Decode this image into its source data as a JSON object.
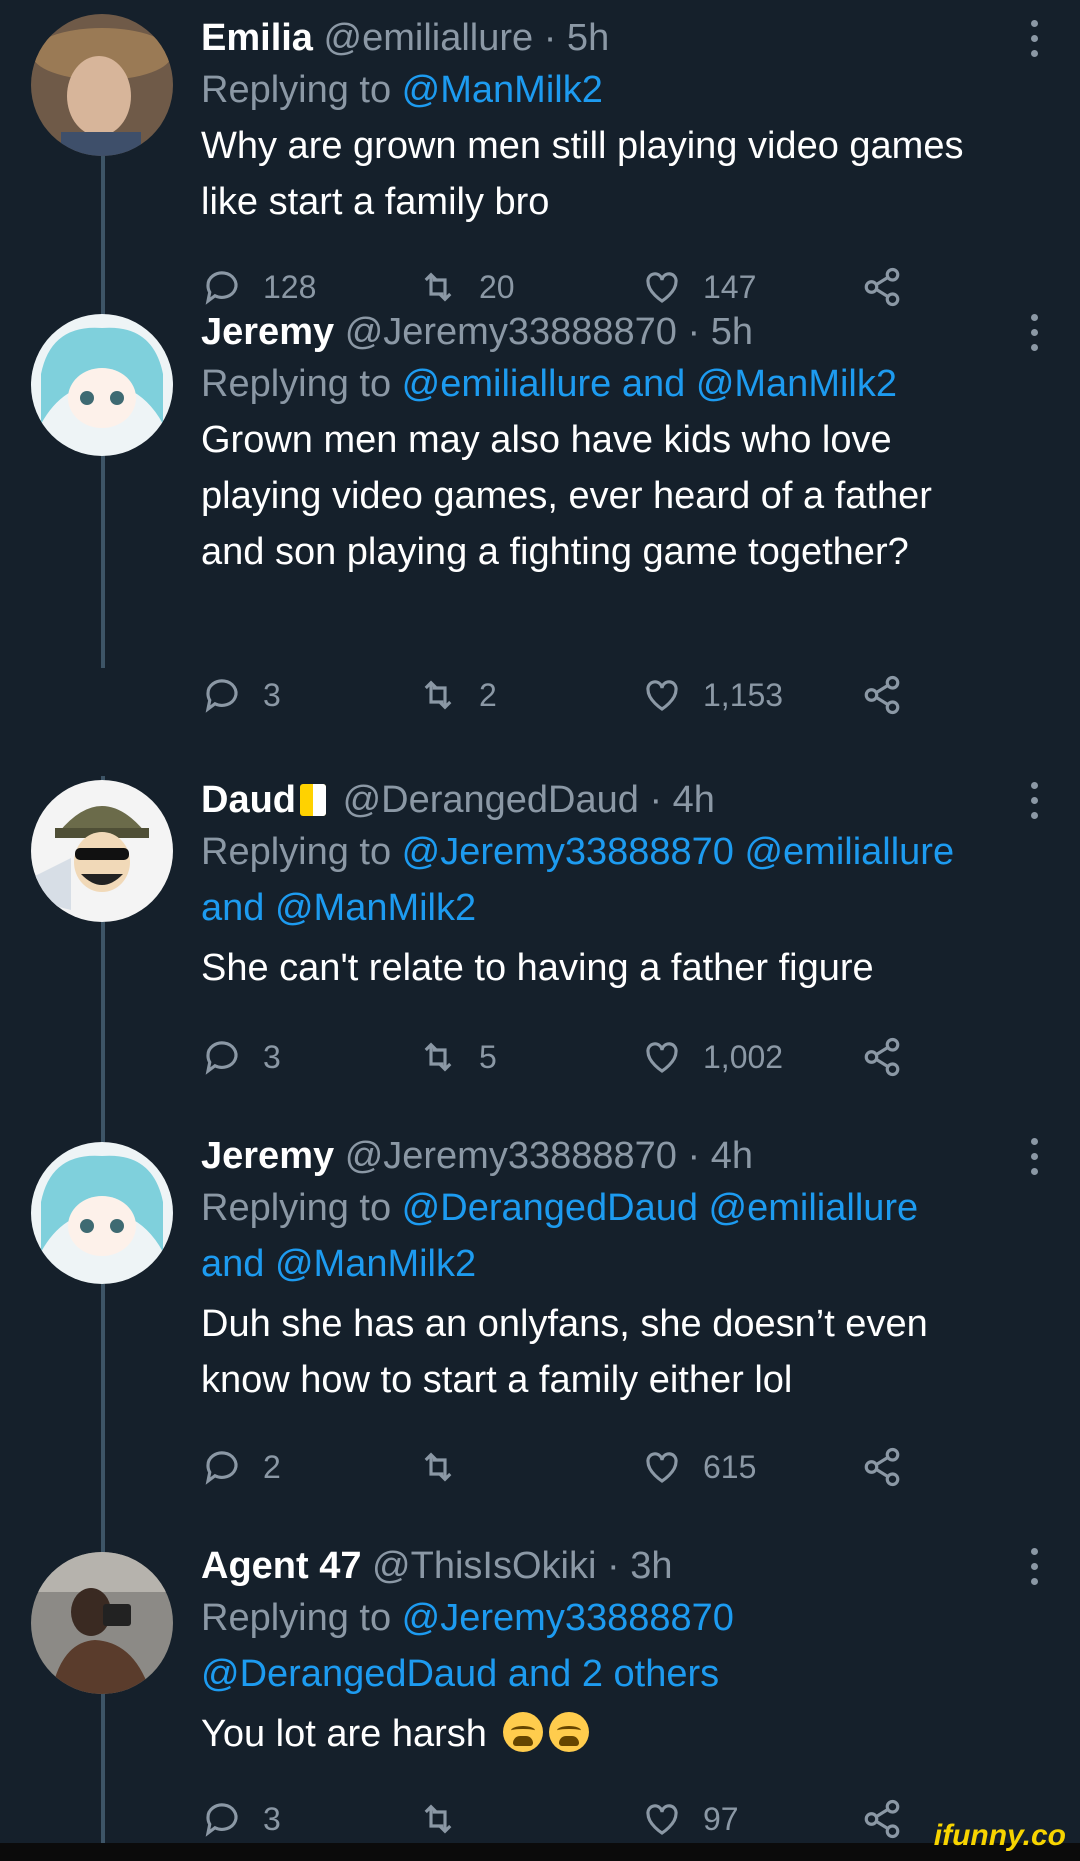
{
  "tweets": [
    {
      "name": "Emilia",
      "handle": "@emiliallure",
      "time": "· 5h",
      "replying_prefix": "Replying to ",
      "replying_to": "@ManMilk2",
      "text_lines": [
        "Why are grown men still playing video games",
        "like start a family bro"
      ],
      "replies": "128",
      "retweets": "20",
      "likes": "147",
      "avatar": "woman-portrait",
      "avatar_color": "#b08a6a"
    },
    {
      "name": "Jeremy",
      "handle": "@Jeremy33888870",
      "time": "· 5h",
      "replying_prefix": "Replying to ",
      "replying_to": "@emiliallure and @ManMilk2",
      "text_lines": [
        "Grown men may also have kids who love",
        "playing video games, ever heard of a father",
        "and son playing a fighting game together?"
      ],
      "replies": "3",
      "retweets": "2",
      "likes": "1,153",
      "avatar": "anime-girl",
      "avatar_color": "#9fdce6"
    },
    {
      "name": "Daud",
      "handle": "@DerangedDaud",
      "time": "· 4h",
      "replying_prefix": "Replying to ",
      "replying_to_line1": "@Jeremy33888870 @emiliallure",
      "replying_to_line2": "and @ManMilk2",
      "text_lines": [
        "She can't relate to having a father figure"
      ],
      "replies": "3",
      "retweets": "5",
      "likes": "1,002",
      "avatar": "anime-bucket-hat",
      "avatar_color": "#6b6b4a"
    },
    {
      "name": "Jeremy",
      "handle": "@Jeremy33888870",
      "time": "· 4h",
      "replying_prefix": "Replying to ",
      "replying_to_line1": "@DerangedDaud @emiliallure",
      "replying_to_line2": "and @ManMilk2",
      "text_lines": [
        "Duh she has an onlyfans, she doesn’t even",
        "know how to start a family either lol"
      ],
      "replies": "2",
      "retweets": "",
      "likes": "615",
      "avatar": "anime-girl",
      "avatar_color": "#9fdce6"
    },
    {
      "name": "Agent 47",
      "handle": "@ThisIsOkiki",
      "time": "· 3h",
      "replying_prefix": "Replying to ",
      "replying_to_line1": "@Jeremy33888870",
      "replying_to_line2": "@DerangedDaud and 2 others",
      "text_lines": [
        "You lot are harsh"
      ],
      "replies": "3",
      "retweets": "",
      "likes": "97",
      "avatar": "man-selfie",
      "avatar_color": "#5a4a3e"
    }
  ],
  "watermark": "ifunny.co",
  "colors": {
    "background": "#15202b",
    "secondary_text": "#8b98a5",
    "link": "#1d9bf0",
    "thread_line": "#3d5466"
  },
  "icons": [
    "reply-icon",
    "retweet-icon",
    "like-icon",
    "share-icon",
    "more-icon",
    "loudly-crying-face-emoji"
  ]
}
